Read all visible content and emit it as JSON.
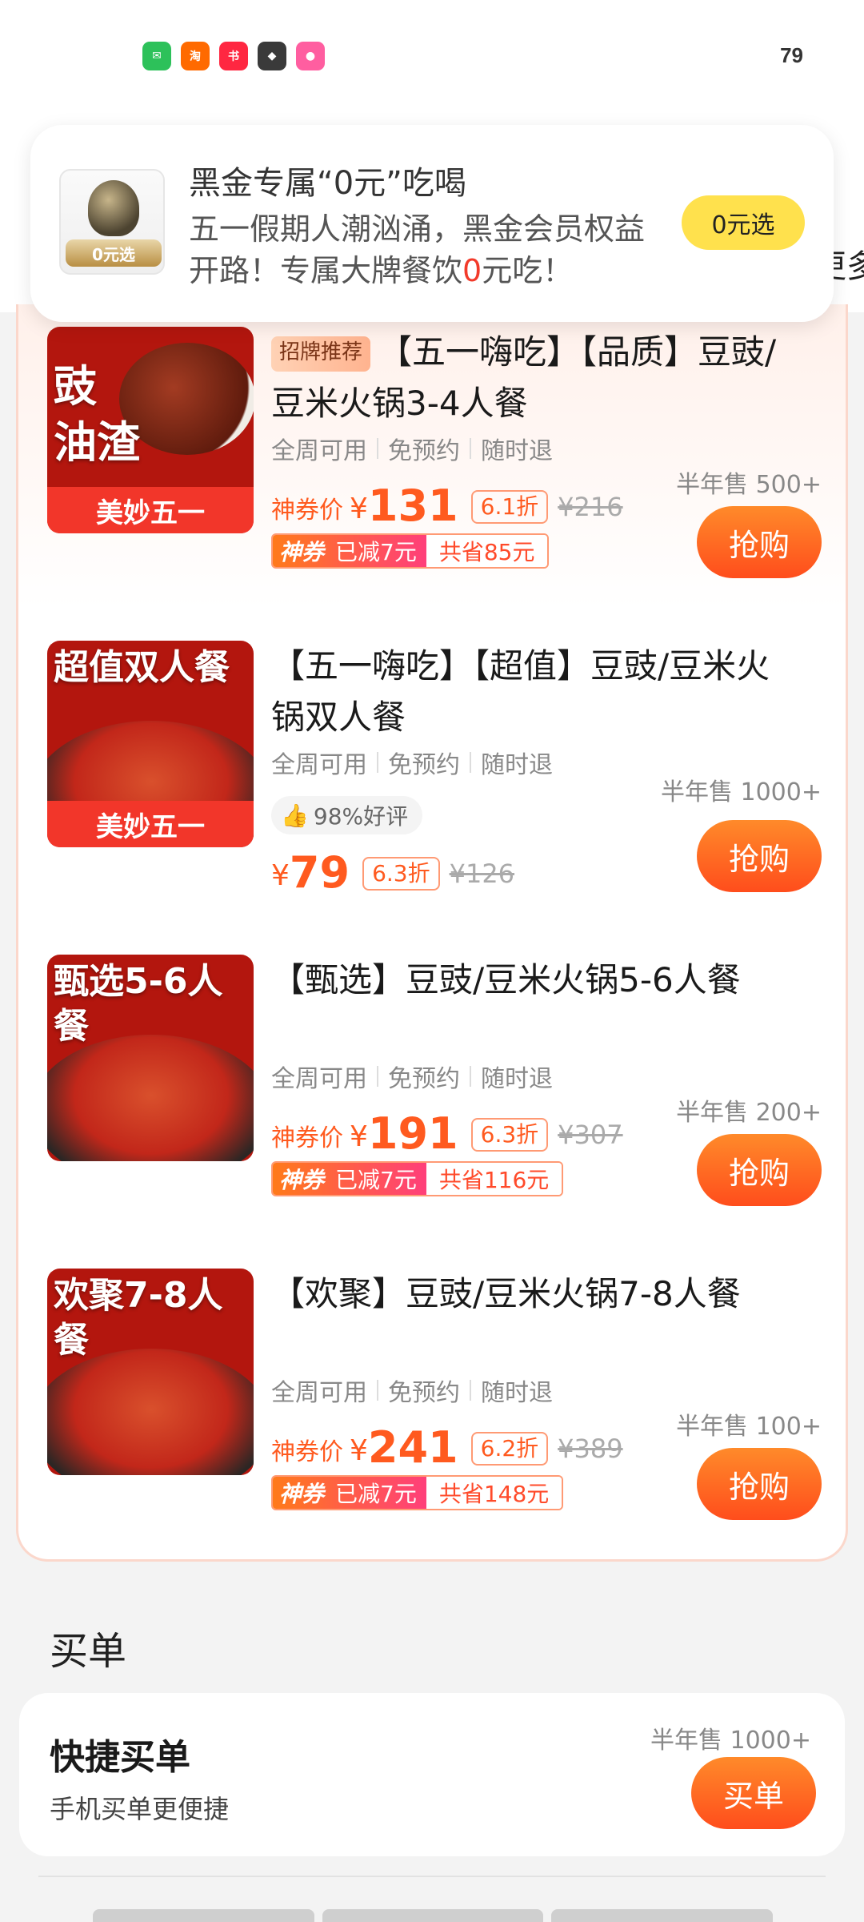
{
  "status_bar": {
    "icons": [
      "wechat-icon",
      "taobao-icon",
      "xiaohongshu-icon",
      "game-icon",
      "app-icon"
    ],
    "battery": "79"
  },
  "header": {
    "more_peek": "更多"
  },
  "notification": {
    "title": "黑金专属“0元”吃喝",
    "body_part1": "五一假期人潮汹涌，黑金会员权益开路！专属大牌餐饮",
    "body_highlight": "0",
    "body_part2": "元吃！",
    "icon_tag": "0元选",
    "button": "0元选"
  },
  "deals": [
    {
      "badge": "招牌推荐",
      "title": "【五一嗨吃】【品质】豆豉/豆米火锅3-4人餐",
      "tags": [
        "全周可用",
        "免预约",
        "随时退"
      ],
      "price_label": "神券价",
      "currency": "¥",
      "price": "131",
      "discount": "6.1折",
      "original": "¥216",
      "coupon_brand": "神券",
      "coupon_off": "已减7元",
      "coupon_save": "共省85元",
      "sold": "半年售 500+",
      "buy": "抢购",
      "thumb_text": "豉\n油渣",
      "thumb_ribbon": "美妙五一"
    },
    {
      "title": "【五一嗨吃】【超值】豆豉/豆米火锅双人餐",
      "tags": [
        "全周可用",
        "免预约",
        "随时退"
      ],
      "rating": "98%好评",
      "currency": "¥",
      "price": "79",
      "discount": "6.3折",
      "original": "¥126",
      "sold": "半年售 1000+",
      "buy": "抢购",
      "thumb_text": "超值双人餐",
      "thumb_ribbon": "美妙五一"
    },
    {
      "title": "【甄选】豆豉/豆米火锅5-6人餐",
      "tags": [
        "全周可用",
        "免预约",
        "随时退"
      ],
      "price_label": "神券价",
      "currency": "¥",
      "price": "191",
      "discount": "6.3折",
      "original": "¥307",
      "coupon_brand": "神券",
      "coupon_off": "已减7元",
      "coupon_save": "共省116元",
      "sold": "半年售 200+",
      "buy": "抢购",
      "thumb_text": "甄选5-6人餐"
    },
    {
      "title": "【欢聚】豆豉/豆米火锅7-8人餐",
      "tags": [
        "全周可用",
        "免预约",
        "随时退"
      ],
      "price_label": "神券价",
      "currency": "¥",
      "price": "241",
      "discount": "6.2折",
      "original": "¥389",
      "coupon_brand": "神券",
      "coupon_off": "已减7元",
      "coupon_save": "共省148元",
      "sold": "半年售 100+",
      "buy": "抢购",
      "thumb_text": "欢聚7-8人餐"
    }
  ],
  "pay_section": {
    "title": "买单",
    "card_title": "快捷买单",
    "card_sub": "手机买单更便捷",
    "sold": "半年售 1000+",
    "button": "买单"
  },
  "colors": {
    "accent": "#ff5a1f",
    "button_gradient_top": "#ff8a2a",
    "button_gradient_bottom": "#ff4d1c",
    "notif_button": "#ffe14d",
    "ribbon": "#f2362a"
  }
}
